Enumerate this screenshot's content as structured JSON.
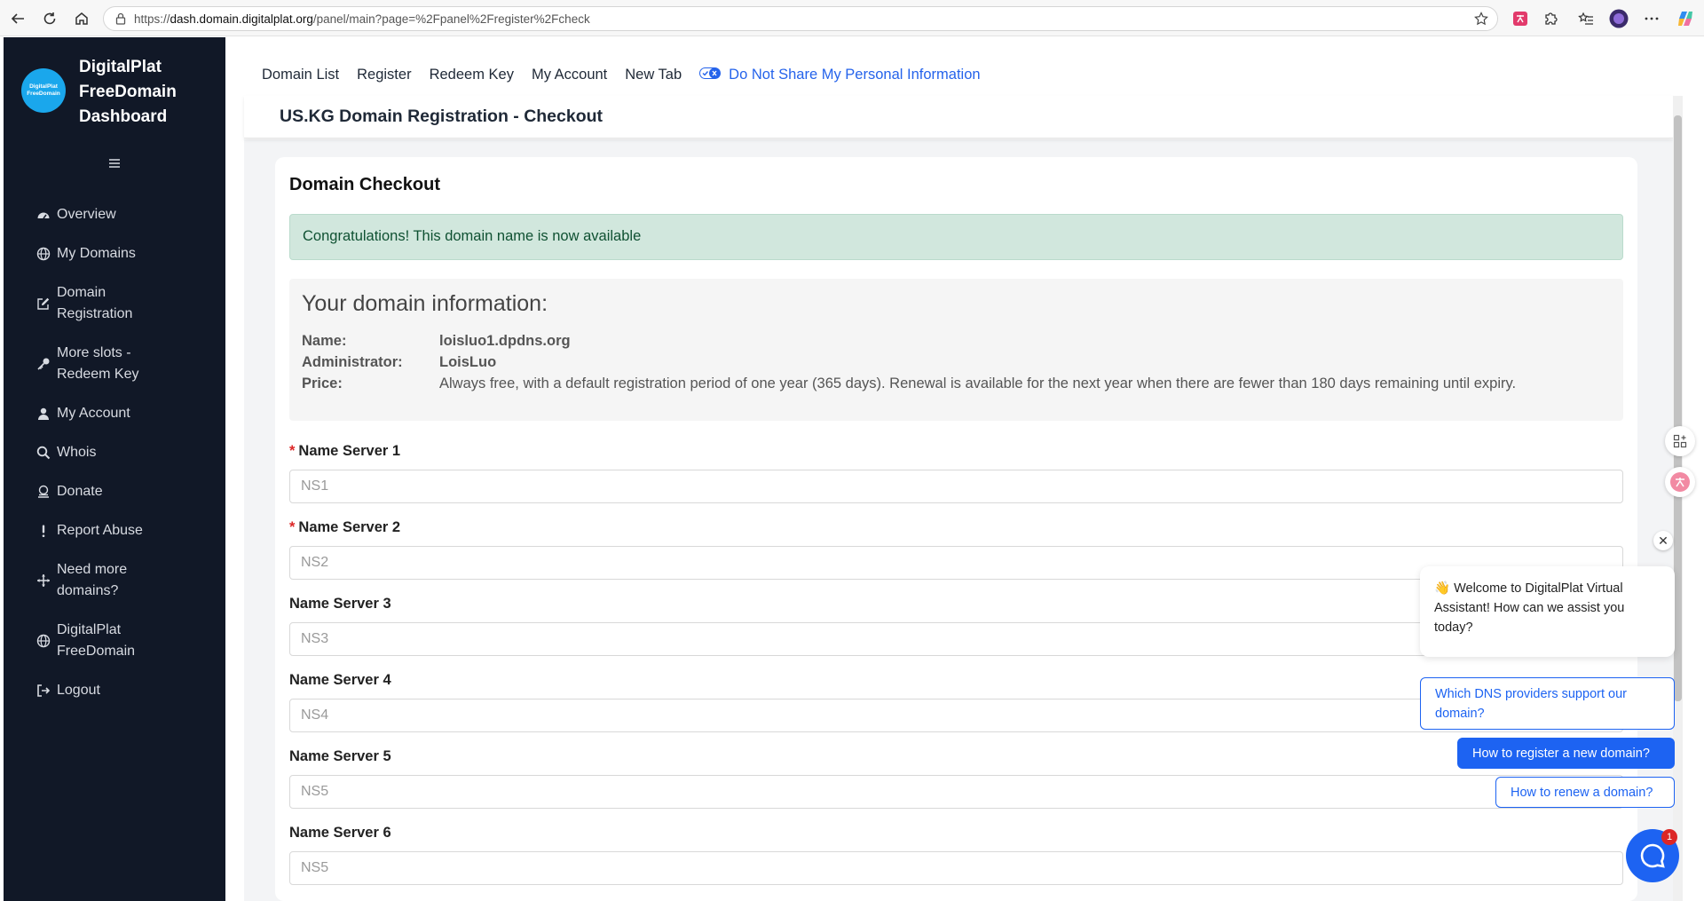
{
  "browser": {
    "url_prefix": "https://",
    "url_host": "dash.domain.digitalplat.org",
    "url_path": "/panel/main?page=%2Fpanel%2Fregister%2Fcheck"
  },
  "sidebar": {
    "logo_text": "DigitalPlat FreeDomain",
    "brand_line1": "DigitalPlat",
    "brand_line2": "FreeDomain",
    "brand_line3": "Dashboard",
    "items": [
      {
        "label": "Overview",
        "icon": "dashboard-icon"
      },
      {
        "label": "My Domains",
        "icon": "globe-icon"
      },
      {
        "label_l1": "Domain",
        "label_l2": "Registration",
        "icon": "edit-icon"
      },
      {
        "label_l1": "More slots -",
        "label_l2": "Redeem Key",
        "icon": "key-icon"
      },
      {
        "label": "My Account",
        "icon": "user-icon"
      },
      {
        "label": "Whois",
        "icon": "search-icon"
      },
      {
        "label": "Donate",
        "icon": "donate-icon"
      },
      {
        "label": "Report Abuse",
        "icon": "exclamation-icon"
      },
      {
        "label_l1": "Need more",
        "label_l2": "domains?",
        "icon": "move-icon"
      },
      {
        "label_l1": "DigitalPlat",
        "label_l2": "FreeDomain",
        "icon": "globe-icon"
      },
      {
        "label": "Logout",
        "icon": "logout-icon"
      }
    ]
  },
  "topnav": {
    "items": [
      "Domain List",
      "Register",
      "Redeem Key",
      "My Account",
      "New Tab"
    ],
    "privacy": "Do Not Share My Personal Information"
  },
  "page": {
    "title": "US.KG Domain Registration - Checkout",
    "card_title": "Domain Checkout",
    "alert": "Congratulations! This domain name is now available",
    "info_heading": "Your domain information:",
    "info": {
      "name_label": "Name:",
      "name_value": "loisluo1.dpdns.org",
      "admin_label": "Administrator:",
      "admin_value": "LoisLuo",
      "price_label": "Price:",
      "price_value": "Always free, with a default registration period of one year (365 days). Renewal is available for the next year when there are fewer than 180 days remaining until expiry."
    },
    "name_servers": [
      {
        "label": "Name Server 1",
        "placeholder": "NS1",
        "required": true
      },
      {
        "label": "Name Server 2",
        "placeholder": "NS2",
        "required": true
      },
      {
        "label": "Name Server 3",
        "placeholder": "NS3",
        "required": false
      },
      {
        "label": "Name Server 4",
        "placeholder": "NS4",
        "required": false
      },
      {
        "label": "Name Server 5",
        "placeholder": "NS5",
        "required": false
      },
      {
        "label": "Name Server 6",
        "placeholder": "NS5",
        "required": false
      }
    ]
  },
  "chat": {
    "welcome": "👋 Welcome to DigitalPlat Virtual Assistant! How can we assist you today?",
    "options": [
      "Which DNS providers support our domain?",
      "How to register a new domain?",
      "How to renew a domain?"
    ],
    "badge": "1",
    "close": "✕"
  },
  "colors": {
    "sidebar_bg": "#111827",
    "accent": "#1d63f2",
    "alert_bg": "#d1e7dd",
    "required": "#dc2626"
  }
}
